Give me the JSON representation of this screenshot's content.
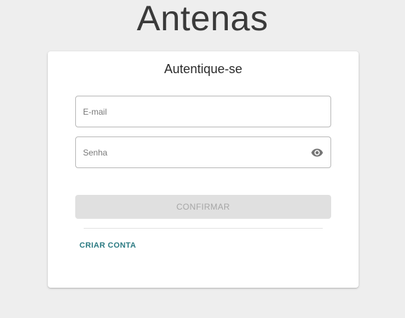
{
  "app": {
    "title": "Antenas"
  },
  "login": {
    "heading": "Autentique-se",
    "email_placeholder": "E-mail",
    "email_value": "",
    "password_placeholder": "Senha",
    "password_value": "",
    "password_toggle_icon": "eye-icon",
    "confirm_label": "CONFIRMAR",
    "create_account_label": "CRIAR CONTA"
  },
  "colors": {
    "background": "#eeeeee",
    "card": "#ffffff",
    "link": "#2b7a82",
    "disabled_button": "#e0e0e0",
    "disabled_text": "#a6a6a6"
  }
}
